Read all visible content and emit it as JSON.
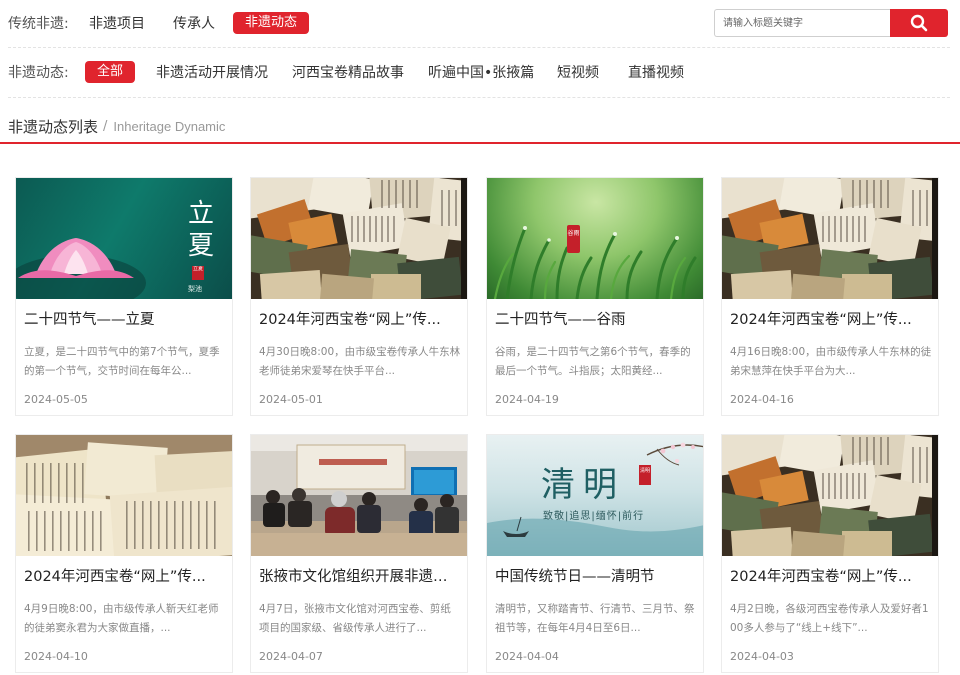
{
  "header": {
    "label": "传统非遗:",
    "nav": [
      "非遗项目",
      "传承人",
      "非遗动态"
    ],
    "active_index": 2,
    "search": {
      "placeholder": "请输入标题关键字"
    }
  },
  "filter": {
    "label": "非遗动态:",
    "items": [
      "全部",
      "非遗活动开展情况",
      "河西宝卷精品故事",
      "听遍中国•张掖篇",
      "短视频",
      "直播视频"
    ],
    "active_index": 0
  },
  "section": {
    "title": "非遗动态列表",
    "separator": "/",
    "subtitle": "Inheritage Dynamic"
  },
  "cards": [
    {
      "title": "二十四节气——立夏",
      "desc": "立夏，是二十四节气中的第7个节气，夏季的第一个节气，交节时间在每年公...",
      "date": "2024-05-05",
      "image": "lixia",
      "overlay_big": "立夏",
      "overlay_seal": "立夏",
      "overlay_small": "梨池"
    },
    {
      "title": "2024年河西宝卷“网上”传...",
      "desc": "4月30日晚8:00，由市级宝卷传承人牛东林老师徒弟宋爱琴在快手平台...",
      "date": "2024-05-01",
      "image": "scrolls"
    },
    {
      "title": "二十四节气——谷雨",
      "desc": "谷雨，是二十四节气之第6个节气，春季的最后一个节气。斗指辰；太阳黄经...",
      "date": "2024-04-19",
      "image": "guyu",
      "overlay_seal": "谷雨"
    },
    {
      "title": "2024年河西宝卷“网上”传...",
      "desc": "4月16日晚8:00，由市级传承人牛东林的徒弟宋慧萍在快手平台为大...",
      "date": "2024-04-16",
      "image": "scrolls"
    },
    {
      "title": "2024年河西宝卷“网上”传...",
      "desc": "4月9日晚8:00，由市级传承人靳天红老师的徒弟窦永君为大家做直播，...",
      "date": "2024-04-10",
      "image": "books"
    },
    {
      "title": "张掖市文化馆组织开展非遗代...",
      "desc": "4月7日，张掖市文化馆对河西宝卷、剪纸项目的国家级、省级传承人进行了...",
      "date": "2024-04-07",
      "image": "meeting"
    },
    {
      "title": "中国传统节日——清明节",
      "desc": "清明节，又称踏青节、行清节、三月节、祭祖节等，在每年4月4日至6日...",
      "date": "2024-04-04",
      "image": "qingming",
      "overlay_big": "清明",
      "overlay_sub": "致敬|追思|缅怀|前行",
      "overlay_seal": "清明"
    },
    {
      "title": "2024年河西宝卷“网上”传...",
      "desc": "4月2日晚，各级河西宝卷传承人及爱好者100多人参与了“线上+线下”...",
      "date": "2024-04-03",
      "image": "scrolls"
    }
  ],
  "colors": {
    "accent": "#e0242d",
    "divider": "#e3e3e3",
    "muted": "#888888"
  },
  "icons": {
    "search": "search-icon"
  }
}
